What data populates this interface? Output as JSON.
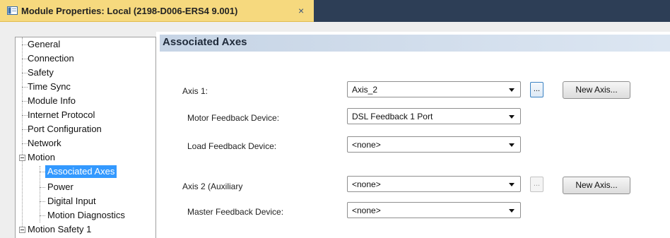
{
  "window": {
    "title": "Module Properties: Local (2198-D006-ERS4 9.001)",
    "close_glyph": "×",
    "icon": "module-icon"
  },
  "tree": {
    "items": [
      {
        "label": "General"
      },
      {
        "label": "Connection"
      },
      {
        "label": "Safety"
      },
      {
        "label": "Time Sync"
      },
      {
        "label": "Module Info"
      },
      {
        "label": "Internet Protocol"
      },
      {
        "label": "Port Configuration"
      },
      {
        "label": "Network"
      },
      {
        "label": "Motion",
        "expanded": true
      },
      {
        "label": "Associated Axes",
        "selected": true
      },
      {
        "label": "Power"
      },
      {
        "label": "Digital Input"
      },
      {
        "label": "Motion Diagnostics"
      },
      {
        "label": "Motion Safety 1",
        "expanded": true
      }
    ]
  },
  "content": {
    "section_title": "Associated Axes",
    "axis1": {
      "label": "Axis 1:",
      "value": "Axis_2",
      "ellipsis": "...",
      "new_axis": "New Axis..."
    },
    "motor_feedback": {
      "label": "Motor Feedback Device:",
      "value": "DSL Feedback 1 Port"
    },
    "load_feedback": {
      "label": "Load Feedback Device:",
      "value": "<none>"
    },
    "axis2": {
      "label": "Axis 2  (Auxiliary",
      "value": "<none>",
      "ellipsis": "...",
      "new_axis": "New Axis..."
    },
    "master_feedback": {
      "label": "Master Feedback Device:",
      "value": "<none>"
    }
  }
}
